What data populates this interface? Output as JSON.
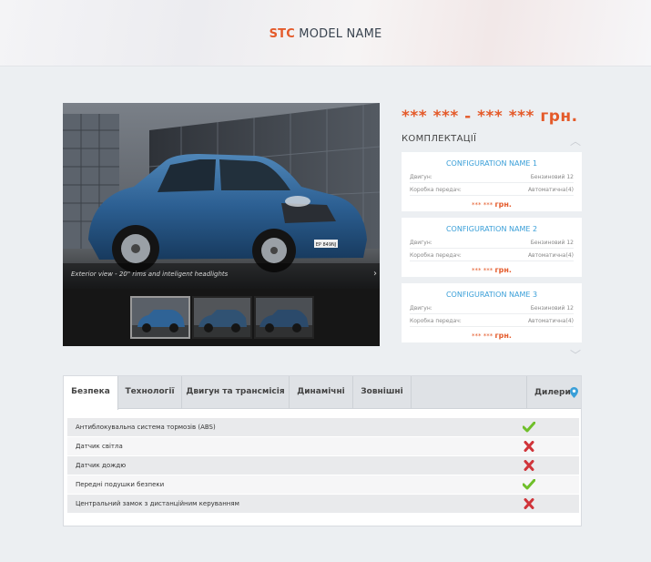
{
  "header": {
    "brand_accent": "STC",
    "brand_rest": " MODEL NAME"
  },
  "gallery": {
    "caption": "Exterior view - 20\" rims and inteligent headlights",
    "license_plate": "EP 849NJ",
    "thumbnails": [
      "thumb-1",
      "thumb-2",
      "thumb-3"
    ],
    "active_thumbnail": 1
  },
  "price": {
    "text": "*** *** - *** ***",
    "currency": "грн."
  },
  "configurations": {
    "title": "КОМПЛЕКТАЦІЇ",
    "items": [
      {
        "name": "CONFIGURATION NAME 1",
        "engine_label": "Двигун:",
        "engine_value": "Бензиновий 12",
        "gearbox_label": "Коробка передач:",
        "gearbox_value": "Автоматична(4)",
        "price": "*** ***",
        "currency": "грн."
      },
      {
        "name": "CONFIGURATION NAME 2",
        "engine_label": "Двигун:",
        "engine_value": "Бензиновий 12",
        "gearbox_label": "Коробка передач:",
        "gearbox_value": "Автоматична(4)",
        "price": "*** ***",
        "currency": "грн."
      },
      {
        "name": "CONFIGURATION NAME 3",
        "engine_label": "Двигун:",
        "engine_value": "Бензиновий 12",
        "gearbox_label": "Коробка передач:",
        "gearbox_value": "Автоматична(4)",
        "price": "*** ***",
        "currency": "грн."
      }
    ]
  },
  "tabs": {
    "items": [
      "Безпека",
      "Технології",
      "Двигун та трансмісія",
      "Динамічні",
      "Зовнішні"
    ],
    "active": "Безпека",
    "dealers_label": "Дилери"
  },
  "features": [
    {
      "label": "Антиблокувальна система тормозів (ABS)",
      "available": true
    },
    {
      "label": "Датчик світла",
      "available": false
    },
    {
      "label": "Датчик дождю",
      "available": false
    },
    {
      "label": "Передні подушки безпеки",
      "available": true
    },
    {
      "label": "Центральний замок з дистанційним керуванням",
      "available": false
    }
  ],
  "colors": {
    "accent": "#e45a2a",
    "link_blue": "#3a9fd8",
    "check_green": "#6fbf2a",
    "cross_red": "#d0343a"
  },
  "icons": {
    "scroll_up": "chevron-up-icon",
    "scroll_down": "chevron-down-icon",
    "dealers": "map-pin-icon",
    "yes": "check-icon",
    "no": "cross-icon"
  }
}
